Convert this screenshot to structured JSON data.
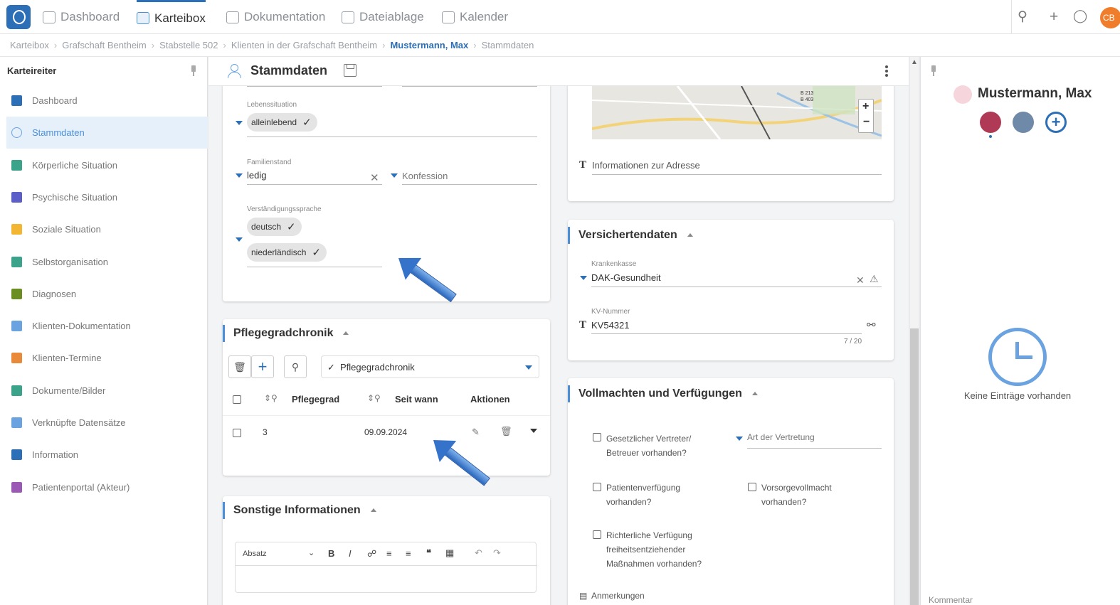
{
  "nav": {
    "tabs": [
      {
        "label": "Dashboard",
        "icon": "dashboard-icon"
      },
      {
        "label": "Karteibox",
        "icon": "card-box-icon",
        "active": true
      },
      {
        "label": "Dokumentation",
        "icon": "document-icon"
      },
      {
        "label": "Dateiablage",
        "icon": "file-storage-icon"
      },
      {
        "label": "Kalender",
        "icon": "calendar-icon"
      }
    ],
    "right_icons": [
      "search-icon",
      "plus-icon",
      "chat-icon"
    ],
    "avatar_initials": "CB"
  },
  "breadcrumb": [
    "Karteibox",
    "Grafschaft Bentheim",
    "Stabstelle 502",
    "Klienten in der Grafschaft Bentheim",
    "Mustermann, Max",
    "Stammdaten"
  ],
  "sidebar": {
    "title": "Karteireiter",
    "items": [
      {
        "label": "Dashboard",
        "icon": "dashboard-icon",
        "color": "#2c6fb6"
      },
      {
        "label": "Stammdaten",
        "icon": "user-icon",
        "color": "#6aa3e0",
        "active": true
      },
      {
        "label": "Körperliche Situation",
        "icon": "heartbeat-icon",
        "color": "#3aa38a"
      },
      {
        "label": "Psychische Situation",
        "icon": "brain-icon",
        "color": "#5b5fc7"
      },
      {
        "label": "Soziale Situation",
        "icon": "people-icon",
        "color": "#f2b632"
      },
      {
        "label": "Selbstorganisation",
        "icon": "edit-icon",
        "color": "#3aa38a"
      },
      {
        "label": "Diagnosen",
        "icon": "chart-area-icon",
        "color": "#6b8e23"
      },
      {
        "label": "Klienten-Dokumentation",
        "icon": "document-icon",
        "color": "#6aa3e0"
      },
      {
        "label": "Klienten-Termine",
        "icon": "calendar-icon",
        "color": "#e88a3a"
      },
      {
        "label": "Dokumente/Bilder",
        "icon": "image-icon",
        "color": "#3aa38a"
      },
      {
        "label": "Verknüpfte Datensätze",
        "icon": "link-icon",
        "color": "#6aa3e0"
      },
      {
        "label": "Information",
        "icon": "pencil-icon",
        "color": "#2c6fb6"
      },
      {
        "label": "Patientenportal (Akteur)",
        "icon": "users-icon",
        "color": "#9b59b6"
      }
    ]
  },
  "main": {
    "title": "Stammdaten",
    "lebenssituation": {
      "label": "Lebenssituation",
      "value": "alleinlebend"
    },
    "familienstand": {
      "label": "Familienstand",
      "value": "ledig"
    },
    "konfession": {
      "placeholder": "Konfession"
    },
    "sprache": {
      "label": "Verständigungssprache",
      "values": [
        "deutsch",
        "niederländisch"
      ]
    },
    "pflege": {
      "title": "Pflegegradchronik",
      "select_value": "Pflegegradchronik",
      "columns": [
        "Pflegegrad",
        "Seit wann",
        "Aktionen"
      ],
      "rows": [
        {
          "pflegegrad": "3",
          "seit": "09.09.2024"
        }
      ]
    },
    "sonstige": {
      "title": "Sonstige Informationen",
      "editor_style": "Absatz"
    },
    "adresse_info": "Informationen zur Adresse",
    "versicherung": {
      "title": "Versichertendaten",
      "kasse_label": "Krankenkasse",
      "kasse_value": "DAK-Gesundheit",
      "kv_label": "KV-Nummer",
      "kv_value": "KV54321",
      "kv_counter": "7 / 20"
    },
    "vollmachten": {
      "title": "Vollmachten und Verfügungen",
      "art_placeholder": "Art der Vertretung",
      "checks": [
        [
          "Gesetzlicher Vertreter/",
          "Betreuer vorhanden?"
        ],
        [
          "Patientenverfügung",
          "vorhanden?"
        ],
        [
          "Vorsorgevollmacht",
          "vorhanden?"
        ],
        [
          "Richterliche Verfügung",
          "freiheitsentziehender",
          "Maßnahmen vorhanden?"
        ]
      ],
      "anmerkungen": "Anmerkungen"
    },
    "map": {
      "labels": [
        "B 213",
        "B 403"
      ]
    }
  },
  "right": {
    "name": "Mustermann, Max",
    "empty": "Keine Einträge vorhanden",
    "kommentar": "Kommentar"
  },
  "colors": {
    "accent": "#2c6fb6",
    "active_bg": "#e6f0fb",
    "arrow": "#3572c9"
  }
}
